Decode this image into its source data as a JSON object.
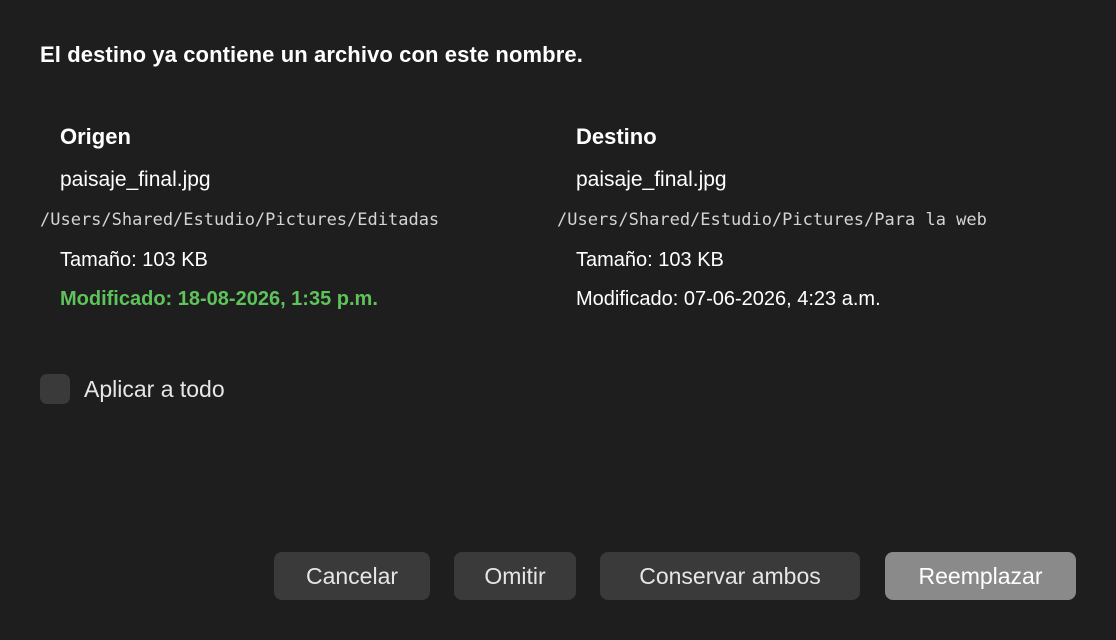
{
  "dialog": {
    "heading": "El destino ya contiene un archivo con este nombre."
  },
  "source": {
    "title": "Origen",
    "filename": "paisaje_final.jpg",
    "path": "/Users/Shared/Estudio/Pictures/Editadas",
    "size": "Tamaño: 103 KB",
    "modified": "Modificado: 18-08-2026, 1:35 p.m.",
    "modified_color": "#5ec35a"
  },
  "destination": {
    "title": "Destino",
    "filename": "paisaje_final.jpg",
    "path": "/Users/Shared/Estudio/Pictures/Para la web",
    "size": "Tamaño: 103 KB",
    "modified": "Modificado: 07-06-2026, 4:23 a.m."
  },
  "apply_all": {
    "label": "Aplicar a todo",
    "checked": false
  },
  "buttons": {
    "cancel": "Cancelar",
    "skip": "Omitir",
    "keep_both": "Conservar ambos",
    "replace": "Reemplazar"
  }
}
